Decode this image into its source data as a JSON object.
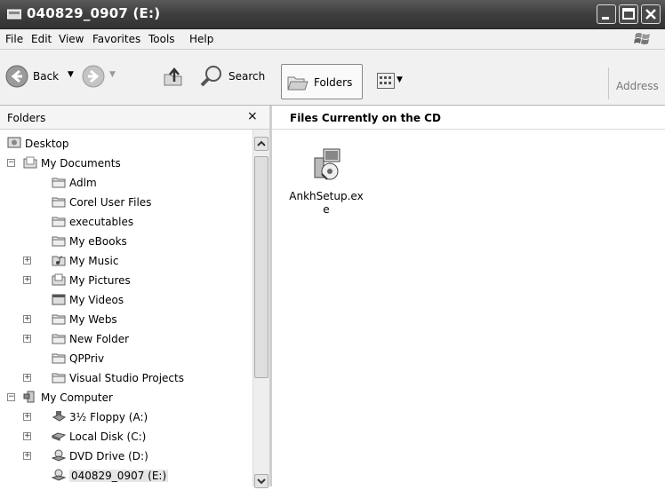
{
  "window": {
    "title": "040829_0907 (E:)"
  },
  "menu": {
    "file": "File",
    "edit": "Edit",
    "view": "View",
    "favorites": "Favorites",
    "tools": "Tools",
    "help": "Help"
  },
  "toolbar": {
    "back": "Back",
    "search": "Search",
    "folders": "Folders",
    "address": "Address"
  },
  "folders_pane": {
    "title": "Folders",
    "close": "×",
    "items": [
      {
        "label": "Desktop"
      },
      {
        "label": "My Documents",
        "expander": "−"
      },
      {
        "label": "Adlm"
      },
      {
        "label": "Corel User Files"
      },
      {
        "label": "executables"
      },
      {
        "label": "My eBooks"
      },
      {
        "label": "My Music",
        "expander": "+"
      },
      {
        "label": "My Pictures",
        "expander": "+"
      },
      {
        "label": "My Videos"
      },
      {
        "label": "My Webs",
        "expander": "+"
      },
      {
        "label": "New Folder",
        "expander": "+"
      },
      {
        "label": "QPPriv"
      },
      {
        "label": "Visual Studio Projects",
        "expander": "+"
      },
      {
        "label": "My Computer",
        "expander": "−"
      },
      {
        "label": "3½ Floppy (A:)",
        "expander": "+"
      },
      {
        "label": "Local Disk (C:)",
        "expander": "+"
      },
      {
        "label": "DVD Drive (D:)",
        "expander": "+"
      },
      {
        "label": "040829_0907 (E:)"
      }
    ]
  },
  "content": {
    "heading": "Files Currently on the CD",
    "files": [
      {
        "name": "AnkhSetup.exe"
      }
    ]
  }
}
